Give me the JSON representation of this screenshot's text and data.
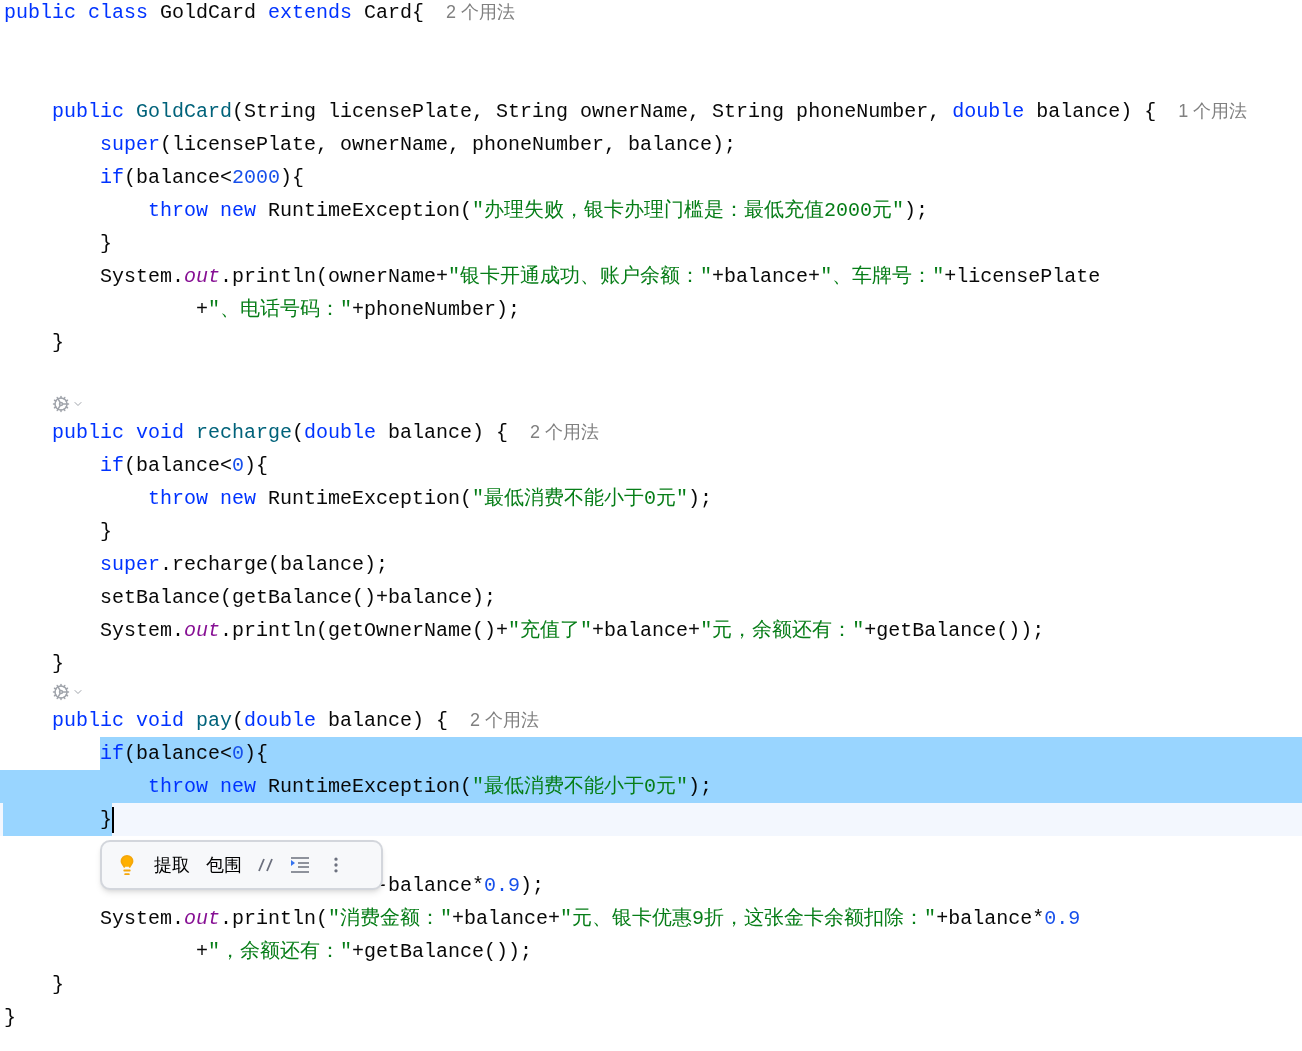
{
  "lines": [
    {
      "kind": "code",
      "tokens": [
        {
          "kind": "kw",
          "s": "public class "
        },
        {
          "kind": "plain",
          "s": "GoldCard "
        },
        {
          "kind": "kw",
          "s": "extends "
        },
        {
          "kind": "plain",
          "s": "Card{"
        }
      ],
      "hint": "2 个用法",
      "children": [
        {
          "kind": "blank"
        },
        {
          "kind": "blank"
        },
        {
          "kind": "code",
          "tokens": [
            {
              "kind": "kw",
              "s": "public "
            },
            {
              "kind": "decl",
              "s": "GoldCard"
            },
            {
              "kind": "plain",
              "s": "(String licensePlate, String ownerName, String phoneNumber, "
            },
            {
              "kind": "kw",
              "s": "double "
            },
            {
              "kind": "plain",
              "s": "balance) {"
            }
          ],
          "hint": "1 个用法",
          "children": [
            {
              "kind": "code",
              "tokens": [
                {
                  "kind": "kw",
                  "s": "super"
                },
                {
                  "kind": "plain",
                  "s": "(licensePlate, ownerName, phoneNumber, balance);"
                }
              ]
            },
            {
              "kind": "code",
              "tokens": [
                {
                  "kind": "kw",
                  "s": "if"
                },
                {
                  "kind": "plain",
                  "s": "(balance<"
                },
                {
                  "kind": "num",
                  "s": "2000"
                },
                {
                  "kind": "plain",
                  "s": "){"
                }
              ],
              "children": [
                {
                  "kind": "code",
                  "tokens": [
                    {
                      "kind": "kw",
                      "s": "throw new "
                    },
                    {
                      "kind": "plain",
                      "s": "RuntimeException("
                    },
                    {
                      "kind": "str",
                      "s": "\"办理失败，银卡办理门槛是：最低充值2000元\""
                    },
                    {
                      "kind": "plain",
                      "s": ");"
                    }
                  ]
                }
              ]
            },
            {
              "kind": "code",
              "tokens": [
                {
                  "kind": "plain",
                  "s": "}"
                }
              ]
            },
            {
              "kind": "code",
              "tokens": [
                {
                  "kind": "plain",
                  "s": "System."
                },
                {
                  "kind": "field",
                  "s": "out"
                },
                {
                  "kind": "plain",
                  "s": ".println(ownerName+"
                },
                {
                  "kind": "str",
                  "s": "\"银卡开通成功、账户余额：\""
                },
                {
                  "kind": "plain",
                  "s": "+balance+"
                },
                {
                  "kind": "str",
                  "s": "\"、车牌号：\""
                },
                {
                  "kind": "plain",
                  "s": "+licensePlate"
                }
              ],
              "children": [
                {
                  "kind": "continuation",
                  "tokens": [
                    {
                      "kind": "plain",
                      "s": "+"
                    },
                    {
                      "kind": "str",
                      "s": "\"、电话号码：\""
                    },
                    {
                      "kind": "plain",
                      "s": "+phoneNumber);"
                    }
                  ]
                }
              ]
            }
          ]
        },
        {
          "kind": "code",
          "tokens": [
            {
              "kind": "plain",
              "s": "}"
            }
          ]
        },
        {
          "kind": "blank"
        },
        {
          "kind": "gutter_icon"
        },
        {
          "kind": "code",
          "tokens": [
            {
              "kind": "kw",
              "s": "public void "
            },
            {
              "kind": "decl",
              "s": "recharge"
            },
            {
              "kind": "plain",
              "s": "("
            },
            {
              "kind": "kw",
              "s": "double "
            },
            {
              "kind": "plain",
              "s": "balance) {"
            }
          ],
          "hint": "2 个用法",
          "children": [
            {
              "kind": "code",
              "tokens": [
                {
                  "kind": "kw",
                  "s": "if"
                },
                {
                  "kind": "plain",
                  "s": "(balance<"
                },
                {
                  "kind": "num",
                  "s": "0"
                },
                {
                  "kind": "plain",
                  "s": "){"
                }
              ],
              "children": [
                {
                  "kind": "code",
                  "tokens": [
                    {
                      "kind": "kw",
                      "s": "throw new "
                    },
                    {
                      "kind": "plain",
                      "s": "RuntimeException("
                    },
                    {
                      "kind": "str",
                      "s": "\"最低消费不能小于0元\""
                    },
                    {
                      "kind": "plain",
                      "s": ");"
                    }
                  ]
                }
              ]
            },
            {
              "kind": "code",
              "tokens": [
                {
                  "kind": "plain",
                  "s": "}"
                }
              ]
            },
            {
              "kind": "code",
              "tokens": [
                {
                  "kind": "kw",
                  "s": "super"
                },
                {
                  "kind": "plain",
                  "s": ".recharge(balance);"
                }
              ]
            },
            {
              "kind": "code",
              "tokens": [
                {
                  "kind": "plain",
                  "s": "setBalance(getBalance()+balance);"
                }
              ]
            },
            {
              "kind": "code",
              "tokens": [
                {
                  "kind": "plain",
                  "s": "System."
                },
                {
                  "kind": "field",
                  "s": "out"
                },
                {
                  "kind": "plain",
                  "s": ".println(getOwnerName()+"
                },
                {
                  "kind": "str",
                  "s": "\"充值了\""
                },
                {
                  "kind": "plain",
                  "s": "+balance+"
                },
                {
                  "kind": "str",
                  "s": "\"元，余额还有：\""
                },
                {
                  "kind": "plain",
                  "s": "+getBalance());"
                }
              ]
            }
          ]
        },
        {
          "kind": "code",
          "tokens": [
            {
              "kind": "plain",
              "s": "}"
            }
          ]
        },
        {
          "kind": "gutter_icon"
        },
        {
          "kind": "code",
          "tokens": [
            {
              "kind": "kw",
              "s": "public void "
            },
            {
              "kind": "decl",
              "s": "pay"
            },
            {
              "kind": "plain",
              "s": "("
            },
            {
              "kind": "kw",
              "s": "double "
            },
            {
              "kind": "plain",
              "s": "balance) {"
            }
          ],
          "hint": "2 个用法",
          "children": [
            {
              "kind": "code",
              "selected": true,
              "tokens": [
                {
                  "kind": "kw",
                  "s": "if"
                },
                {
                  "kind": "plain",
                  "s": "(balance<"
                },
                {
                  "kind": "num",
                  "s": "0"
                },
                {
                  "kind": "plain",
                  "s": "){"
                }
              ],
              "children": [
                {
                  "kind": "code",
                  "selected": true,
                  "tokens": [
                    {
                      "kind": "kw",
                      "s": "throw new "
                    },
                    {
                      "kind": "plain",
                      "s": "RuntimeException("
                    },
                    {
                      "kind": "str",
                      "s": "\"最低消费不能小于0元\""
                    },
                    {
                      "kind": "plain",
                      "s": ");"
                    }
                  ]
                }
              ]
            },
            {
              "kind": "code",
              "selected": true,
              "current": true,
              "caret": true,
              "tokens": [
                {
                  "kind": "plain",
                  "s": "}"
                }
              ]
            },
            {
              "kind": "toolbar",
              "actions": [
                {
                  "kind": "bulb"
                },
                {
                  "kind": "text",
                  "label": "提取"
                },
                {
                  "kind": "text",
                  "label": "包围"
                },
                {
                  "kind": "comment"
                },
                {
                  "kind": "indent"
                },
                {
                  "kind": "more"
                }
              ]
            },
            {
              "kind": "covered",
              "tokens": [
                {
                  "kind": "plain",
                  "s": "-balance*"
                },
                {
                  "kind": "num",
                  "s": "0.9"
                },
                {
                  "kind": "plain",
                  "s": ");"
                }
              ]
            },
            {
              "kind": "code",
              "tokens": [
                {
                  "kind": "plain",
                  "s": "System."
                },
                {
                  "kind": "field",
                  "s": "out"
                },
                {
                  "kind": "plain",
                  "s": ".println("
                },
                {
                  "kind": "str",
                  "s": "\"消费金额：\""
                },
                {
                  "kind": "plain",
                  "s": "+balance+"
                },
                {
                  "kind": "str",
                  "s": "\"元、银卡优惠9折，这张金卡余额扣除：\""
                },
                {
                  "kind": "plain",
                  "s": "+balance*"
                },
                {
                  "kind": "num",
                  "s": "0.9"
                }
              ],
              "children": [
                {
                  "kind": "continuation",
                  "tokens": [
                    {
                      "kind": "plain",
                      "s": "+"
                    },
                    {
                      "kind": "str",
                      "s": "\"，余额还有：\""
                    },
                    {
                      "kind": "plain",
                      "s": "+getBalance());"
                    }
                  ]
                }
              ]
            }
          ]
        },
        {
          "kind": "code",
          "tokens": [
            {
              "kind": "plain",
              "s": "}"
            }
          ]
        }
      ]
    },
    {
      "kind": "code",
      "tokens": [
        {
          "kind": "plain",
          "s": "}"
        }
      ]
    }
  ]
}
